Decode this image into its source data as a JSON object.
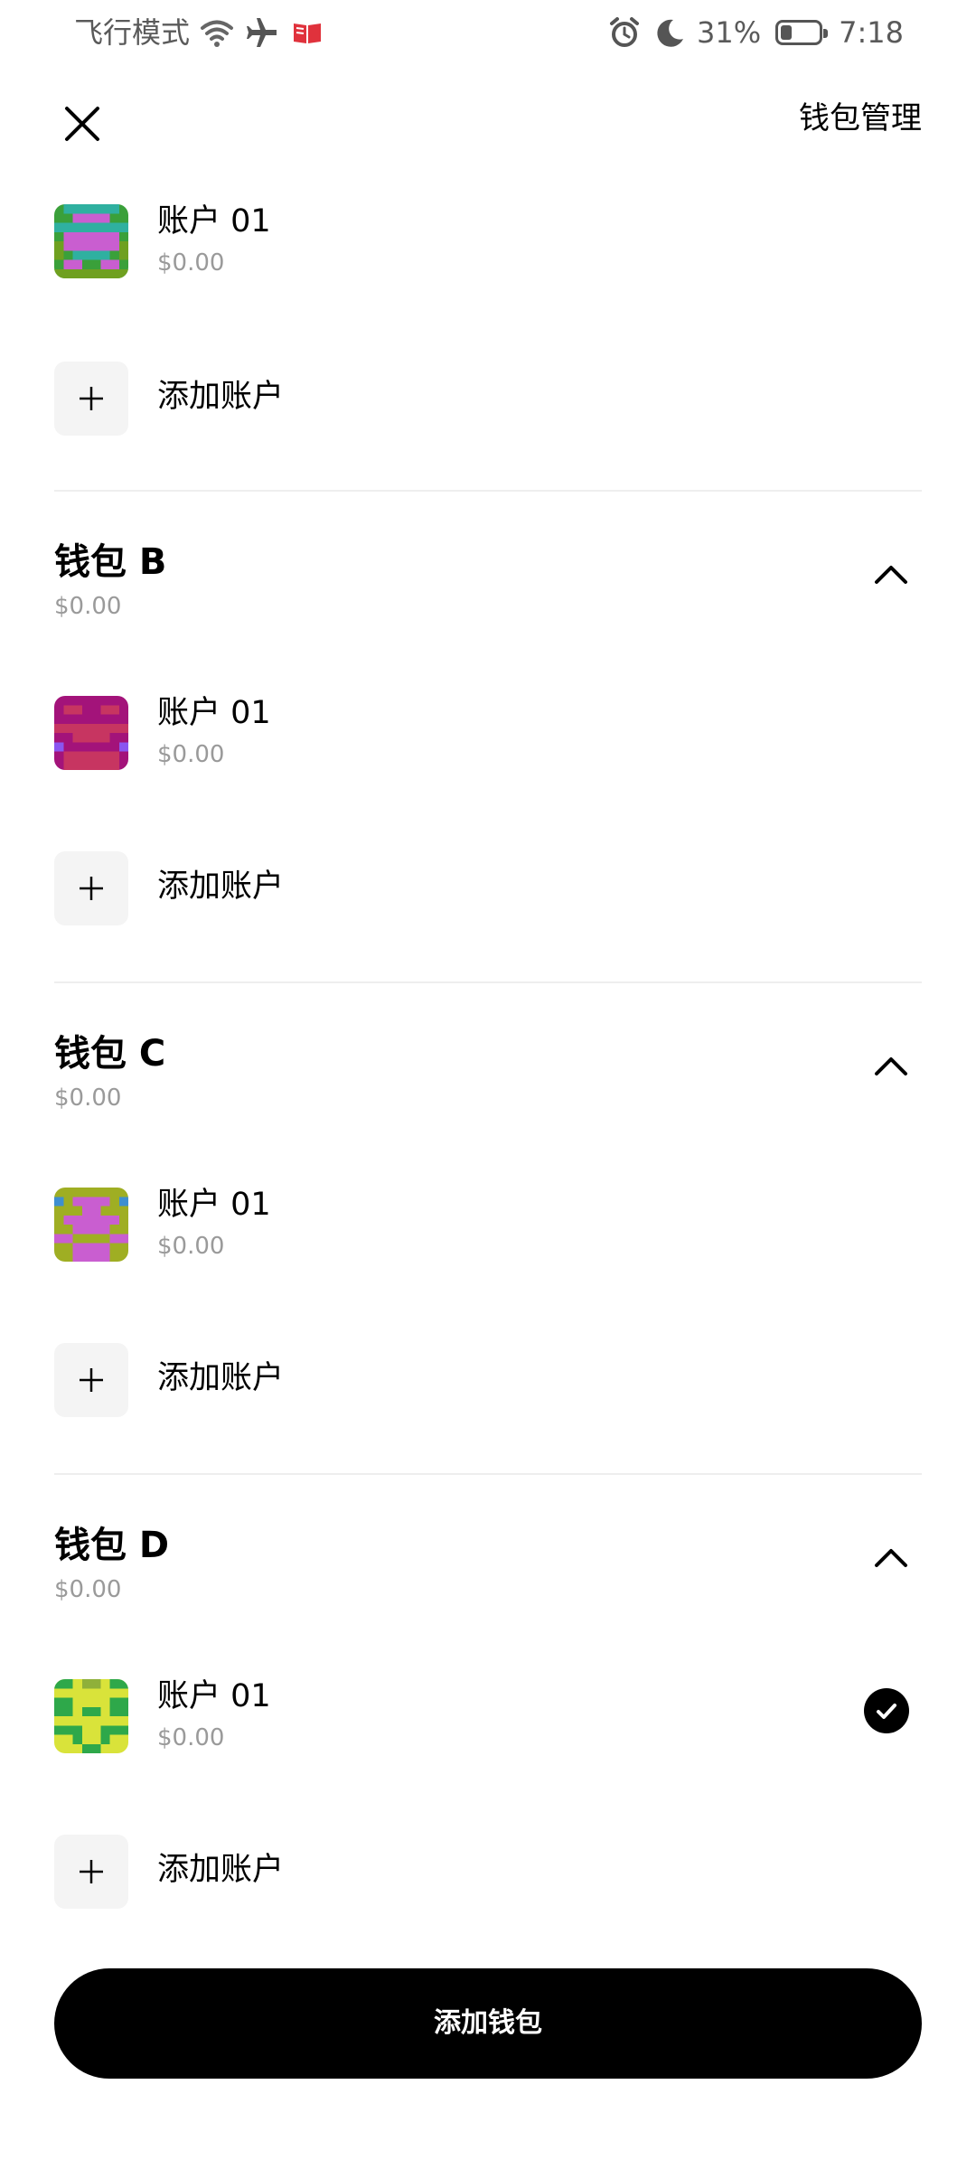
{
  "status_bar": {
    "left_text": "飞行模式",
    "battery": "31%",
    "time": "7:18",
    "icons": [
      "wifi-icon",
      "airplane-icon",
      "book-icon",
      "alarm-icon",
      "moon-icon",
      "battery-icon"
    ],
    "battery_level": 0.31
  },
  "header": {
    "manage_label": "钱包管理"
  },
  "wallets": [
    {
      "name": "",
      "balance": "",
      "accounts": [
        {
          "name": "账户 01",
          "balance": "$0.00",
          "selected": false
        }
      ],
      "add_account_label": "添加账户"
    },
    {
      "name": "钱包 B",
      "balance": "$0.00",
      "accounts": [
        {
          "name": "账户 01",
          "balance": "$0.00",
          "selected": false
        }
      ],
      "add_account_label": "添加账户"
    },
    {
      "name": "钱包 C",
      "balance": "$0.00",
      "accounts": [
        {
          "name": "账户 01",
          "balance": "$0.00",
          "selected": false
        }
      ],
      "add_account_label": "添加账户"
    },
    {
      "name": "钱包 D",
      "balance": "$0.00",
      "accounts": [
        {
          "name": "账户 01",
          "balance": "$0.00",
          "selected": true
        }
      ],
      "add_account_label": "添加账户"
    }
  ],
  "footer": {
    "add_wallet_label": "添加钱包"
  },
  "colors": {
    "primary": "#000000",
    "muted_text": "#9a9a9a",
    "divider": "#eeeeee",
    "plus_bg": "#f4f4f4"
  }
}
